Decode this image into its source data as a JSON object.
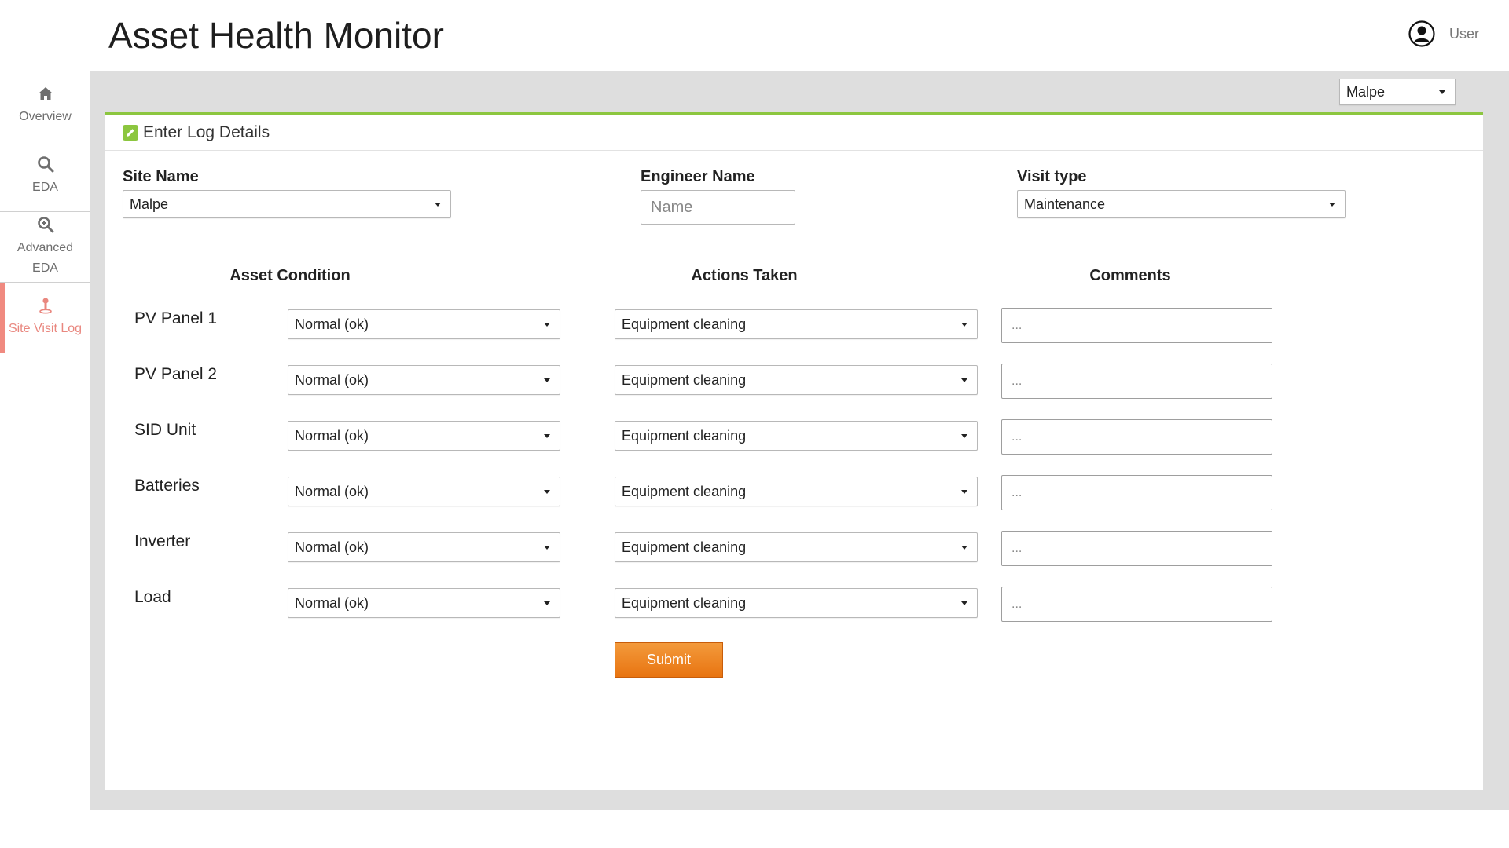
{
  "app": {
    "title": "Asset Health Monitor"
  },
  "user": {
    "label": "User",
    "icon": "user-circle-icon"
  },
  "sidebar": {
    "items": [
      {
        "label": "Overview",
        "icon": "home-icon",
        "active": false
      },
      {
        "label": "EDA",
        "icon": "search-icon",
        "active": false
      },
      {
        "label": "Advanced EDA",
        "icon": "zoom-in-icon",
        "active": false
      },
      {
        "label": "Site Visit Log",
        "icon": "pin-icon",
        "active": true
      }
    ]
  },
  "site_selector": {
    "value": "Malpe"
  },
  "panel": {
    "title": "Enter Log Details",
    "icon": "edit-icon"
  },
  "form": {
    "site_name": {
      "label": "Site Name",
      "value": "Malpe"
    },
    "engineer_name": {
      "label": "Engineer Name",
      "placeholder": "Name",
      "value": ""
    },
    "visit_type": {
      "label": "Visit type",
      "value": "Maintenance"
    }
  },
  "table": {
    "headers": [
      "Asset Condition",
      "Actions Taken",
      "Comments"
    ],
    "rows": [
      {
        "asset": "PV Panel 1",
        "condition": "Normal (ok)",
        "action": "Equipment cleaning",
        "comment_placeholder": "..."
      },
      {
        "asset": "PV Panel 2",
        "condition": "Normal (ok)",
        "action": "Equipment cleaning",
        "comment_placeholder": "..."
      },
      {
        "asset": "SID Unit",
        "condition": "Normal (ok)",
        "action": "Equipment cleaning",
        "comment_placeholder": "..."
      },
      {
        "asset": "Batteries",
        "condition": "Normal (ok)",
        "action": "Equipment cleaning",
        "comment_placeholder": "..."
      },
      {
        "asset": "Inverter",
        "condition": "Normal (ok)",
        "action": "Equipment cleaning",
        "comment_placeholder": "..."
      },
      {
        "asset": "Load",
        "condition": "Normal (ok)",
        "action": "Equipment cleaning",
        "comment_placeholder": "..."
      }
    ]
  },
  "submit": {
    "label": "Submit"
  },
  "colors": {
    "accent_green": "#8cc63f",
    "active_nav": "#f08a80",
    "submit_orange": "#ee7d1c",
    "content_bg": "#dedede"
  }
}
